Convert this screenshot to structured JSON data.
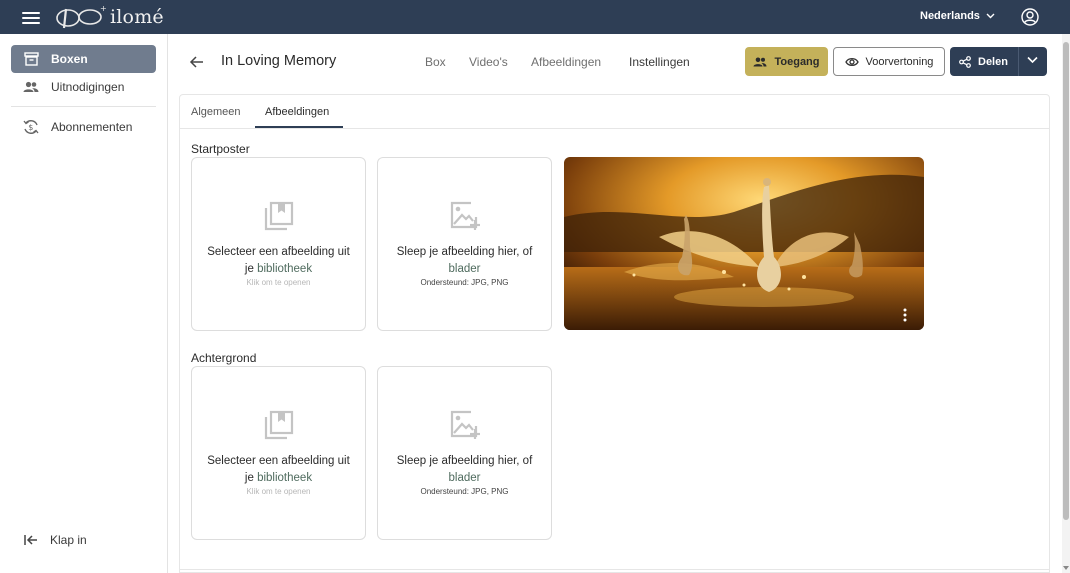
{
  "topbar": {
    "logo_text": "ilomé",
    "language": "Nederlands",
    "bg_color": "#2e3e55"
  },
  "sidebar": {
    "items": [
      {
        "label": "Boxen",
        "icon": "archive-box-icon",
        "active": true
      },
      {
        "label": "Uitnodigingen",
        "icon": "people-icon",
        "active": false
      },
      {
        "label": "Abonnementen",
        "icon": "subscription-icon",
        "active": false
      }
    ],
    "collapse_label": "Klap in"
  },
  "header": {
    "title": "In Loving Memory",
    "tabs": [
      "Box",
      "Video's",
      "Afbeeldingen",
      "Instellingen"
    ],
    "access_label": "Toegang",
    "preview_label": "Voorvertoning",
    "share_label": "Delen",
    "accent_color": "#c4b15a"
  },
  "subtabs": [
    "Algemeen",
    "Afbeeldingen"
  ],
  "sections": {
    "startposter": {
      "label": "Startposter",
      "library_card": {
        "line1": "Selecteer een afbeelding uit",
        "line2_prefix": "je ",
        "line2_link": "bibliotheek",
        "hint": "Klik om te openen"
      },
      "upload_card": {
        "line1": "Sleep je afbeelding hier, of",
        "line2_link": "blader",
        "hint": "Ondersteund: JPG, PNG"
      }
    },
    "achtergrond": {
      "label": "Achtergrond",
      "library_card": {
        "line1": "Selecteer een afbeelding uit",
        "line2_prefix": "je ",
        "line2_link": "bibliotheek",
        "hint": "Klik om te openen"
      },
      "upload_card": {
        "line1": "Sleep je afbeelding hier, of",
        "line2_link": "blader",
        "hint": "Ondersteund: JPG, PNG"
      }
    }
  }
}
